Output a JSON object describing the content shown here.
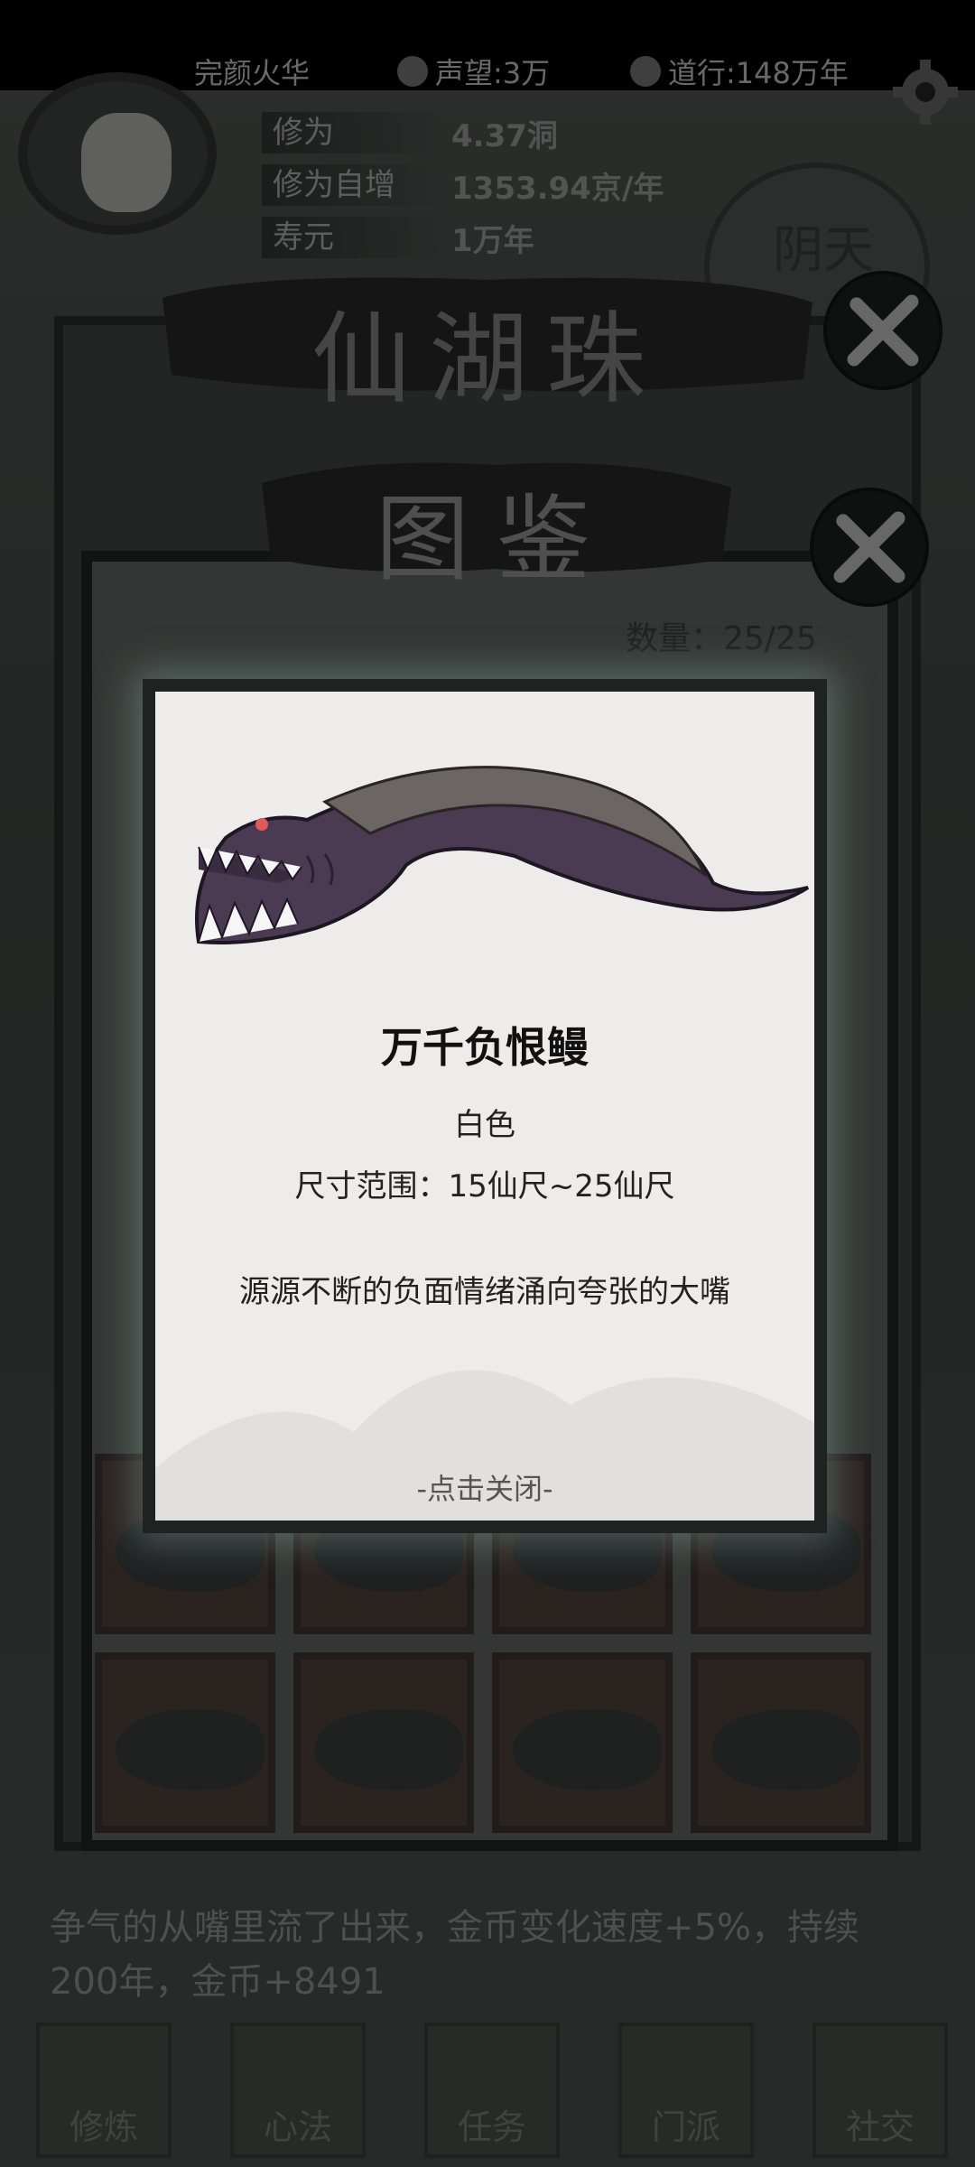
{
  "header": {
    "player_name": "完颜火华",
    "reputation": "声望:3万",
    "daoxing": "道行:148万年"
  },
  "stats": [
    {
      "label": "修为",
      "value": "4.37洞"
    },
    {
      "label": "修为自增",
      "value": "1353.94京/年"
    },
    {
      "label": "寿元",
      "value": "1万年"
    }
  ],
  "weather": "阴天",
  "lake": {
    "title": "仙湖珠"
  },
  "codex": {
    "title": "图鉴",
    "count": "数量：25/25"
  },
  "detail": {
    "name": "万千负恨鳗",
    "color": "白色",
    "size_range": "尺寸范围：15仙尺~25仙尺",
    "description": "源源不断的负面情绪涌向夸张的大嘴",
    "close_hint": "-点击关闭-"
  },
  "log": {
    "text": "争气的从嘴里流了出来，金币变化速度+5%，持续200年，金币+8491"
  },
  "nav": [
    {
      "label": "修炼",
      "icon": "meditate-icon"
    },
    {
      "label": "心法",
      "icon": "scroll-icon"
    },
    {
      "label": "任务",
      "icon": "task-icon"
    },
    {
      "label": "门派",
      "icon": "sect-icon"
    },
    {
      "label": "社交",
      "icon": "social-icon"
    }
  ],
  "colors": {
    "dialog_bg": "#eeecea",
    "eel_body": "#4a3a52",
    "panel_border": "#1e2220"
  }
}
